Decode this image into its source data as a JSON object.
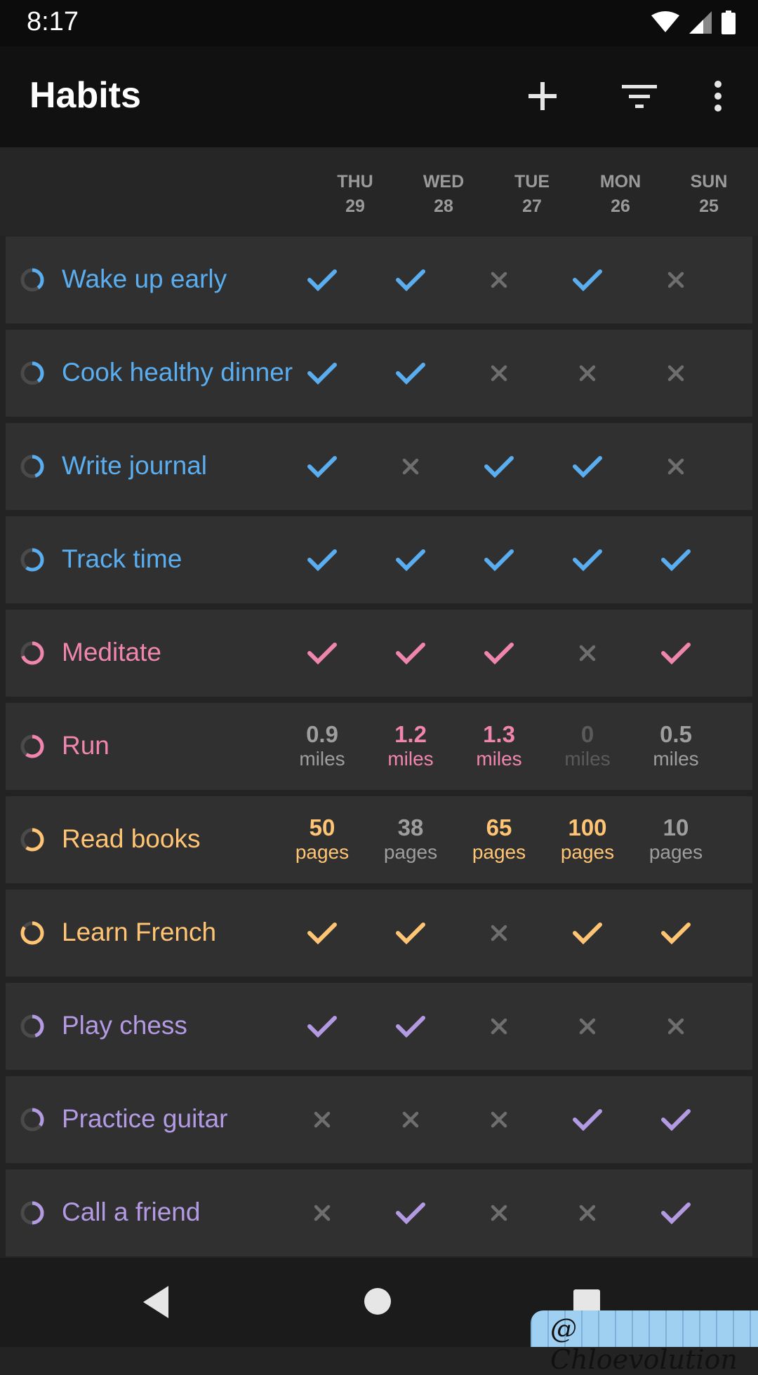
{
  "status": {
    "time": "8:17",
    "icons": [
      "wifi-icon",
      "signal-icon",
      "battery-icon"
    ]
  },
  "app_bar": {
    "title": "Habits",
    "actions": [
      "add-icon",
      "filter-icon",
      "more-vert-icon"
    ]
  },
  "days": [
    {
      "dow": "THU",
      "date": "29"
    },
    {
      "dow": "WED",
      "date": "28"
    },
    {
      "dow": "TUE",
      "date": "27"
    },
    {
      "dow": "MON",
      "date": "26"
    },
    {
      "dow": "SUN",
      "date": "25"
    }
  ],
  "colors": {
    "blue": "#5aaef0",
    "pink": "#f086ae",
    "orange": "#ffc574",
    "purple": "#b39ae3",
    "inactive": "#6e6e6e",
    "ring_track": "#4a4a4a"
  },
  "habits": [
    {
      "name": "Wake up early",
      "color": "#5aaef0",
      "score": 0.4,
      "cells": [
        {
          "type": "check",
          "done": true
        },
        {
          "type": "check",
          "done": true
        },
        {
          "type": "check",
          "done": false
        },
        {
          "type": "check",
          "done": true
        },
        {
          "type": "check",
          "done": false
        }
      ]
    },
    {
      "name": "Cook healthy dinner",
      "color": "#5aaef0",
      "score": 0.4,
      "cells": [
        {
          "type": "check",
          "done": true
        },
        {
          "type": "check",
          "done": true
        },
        {
          "type": "check",
          "done": false
        },
        {
          "type": "check",
          "done": false
        },
        {
          "type": "check",
          "done": false
        }
      ]
    },
    {
      "name": "Write journal",
      "color": "#5aaef0",
      "score": 0.45,
      "cells": [
        {
          "type": "check",
          "done": true
        },
        {
          "type": "check",
          "done": false
        },
        {
          "type": "check",
          "done": true
        },
        {
          "type": "check",
          "done": true
        },
        {
          "type": "check",
          "done": false
        }
      ]
    },
    {
      "name": "Track time",
      "color": "#5aaef0",
      "score": 0.6,
      "cells": [
        {
          "type": "check",
          "done": true
        },
        {
          "type": "check",
          "done": true
        },
        {
          "type": "check",
          "done": true
        },
        {
          "type": "check",
          "done": true
        },
        {
          "type": "check",
          "done": true
        }
      ]
    },
    {
      "name": "Meditate",
      "color": "#f086ae",
      "score": 0.7,
      "cells": [
        {
          "type": "check",
          "done": true
        },
        {
          "type": "check",
          "done": true
        },
        {
          "type": "check",
          "done": true
        },
        {
          "type": "check",
          "done": false
        },
        {
          "type": "check",
          "done": true
        }
      ]
    },
    {
      "name": "Run",
      "color": "#f086ae",
      "score": 0.6,
      "cells": [
        {
          "type": "num",
          "value": "0.9",
          "unit": "miles",
          "state": "neutral"
        },
        {
          "type": "num",
          "value": "1.2",
          "unit": "miles",
          "state": "done"
        },
        {
          "type": "num",
          "value": "1.3",
          "unit": "miles",
          "state": "done"
        },
        {
          "type": "num",
          "value": "0",
          "unit": "miles",
          "state": "off"
        },
        {
          "type": "num",
          "value": "0.5",
          "unit": "miles",
          "state": "neutral"
        }
      ]
    },
    {
      "name": "Read books",
      "color": "#ffc574",
      "score": 0.6,
      "cells": [
        {
          "type": "num",
          "value": "50",
          "unit": "pages",
          "state": "done"
        },
        {
          "type": "num",
          "value": "38",
          "unit": "pages",
          "state": "neutral"
        },
        {
          "type": "num",
          "value": "65",
          "unit": "pages",
          "state": "done"
        },
        {
          "type": "num",
          "value": "100",
          "unit": "pages",
          "state": "done"
        },
        {
          "type": "num",
          "value": "10",
          "unit": "pages",
          "state": "neutral"
        }
      ]
    },
    {
      "name": "Learn French",
      "color": "#ffc574",
      "score": 0.85,
      "cells": [
        {
          "type": "check",
          "done": true
        },
        {
          "type": "check",
          "done": true
        },
        {
          "type": "check",
          "done": false
        },
        {
          "type": "check",
          "done": true
        },
        {
          "type": "check",
          "done": true
        }
      ]
    },
    {
      "name": "Play chess",
      "color": "#b39ae3",
      "score": 0.45,
      "cells": [
        {
          "type": "check",
          "done": true
        },
        {
          "type": "check",
          "done": true
        },
        {
          "type": "check",
          "done": false
        },
        {
          "type": "check",
          "done": false
        },
        {
          "type": "check",
          "done": false
        }
      ]
    },
    {
      "name": "Practice guitar",
      "color": "#b39ae3",
      "score": 0.35,
      "cells": [
        {
          "type": "check",
          "done": false
        },
        {
          "type": "check",
          "done": false
        },
        {
          "type": "check",
          "done": false
        },
        {
          "type": "check",
          "done": true
        },
        {
          "type": "check",
          "done": true
        }
      ]
    },
    {
      "name": "Call a friend",
      "color": "#b39ae3",
      "score": 0.5,
      "cells": [
        {
          "type": "check",
          "done": false
        },
        {
          "type": "check",
          "done": true
        },
        {
          "type": "check",
          "done": false
        },
        {
          "type": "check",
          "done": false
        },
        {
          "type": "check",
          "done": true
        }
      ]
    }
  ],
  "nav": [
    "back-icon",
    "home-icon",
    "recents-icon"
  ],
  "watermark": {
    "text": "@ Chloevolution"
  }
}
